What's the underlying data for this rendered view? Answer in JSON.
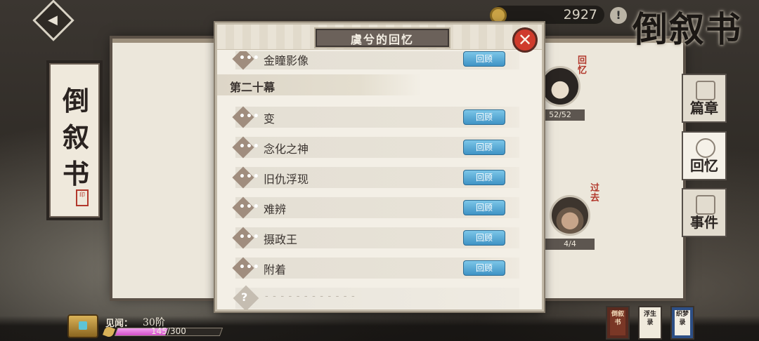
{
  "top_bar": {
    "currency_value": "2927",
    "logo_text": "倒叙书"
  },
  "left_scroll": {
    "title": "倒叙书",
    "seal": "印"
  },
  "side_tabs": [
    {
      "label": "篇章",
      "active": false
    },
    {
      "label": "回忆",
      "active": true
    },
    {
      "label": "事件",
      "active": false
    }
  ],
  "characters": [
    {
      "tag": "回忆",
      "count": "52/52"
    },
    {
      "tag": "过去",
      "count": "4/4"
    }
  ],
  "panel": {
    "title": "虞兮的回忆",
    "close_glyph": "✕",
    "partial_top_row": {
      "name": "金瞳影像",
      "button": "回顾"
    },
    "section_title": "第二十幕",
    "rows": [
      {
        "name": "变",
        "button": "回顾"
      },
      {
        "name": "念化之神",
        "button": "回顾"
      },
      {
        "name": "旧仇浮现",
        "button": "回顾"
      },
      {
        "name": "难辨",
        "button": "回顾"
      },
      {
        "name": "摄政王",
        "button": "回顾"
      },
      {
        "name": "附着",
        "button": "回顾"
      }
    ],
    "locked_row": {
      "icon": "?",
      "placeholder": "- - - - - - - - - - - -"
    }
  },
  "bottom": {
    "exp_label": "见闻：",
    "exp_level": "30阶",
    "exp_value": "145/300",
    "exp_progress": 0.48,
    "books": [
      {
        "label": "倒叙书"
      },
      {
        "label": "浮生录"
      },
      {
        "label": "织梦录"
      }
    ]
  },
  "colors": {
    "review_button": "#3f93c5",
    "close_button": "#cf3b2b",
    "exp_fill": "#d24ec8"
  }
}
